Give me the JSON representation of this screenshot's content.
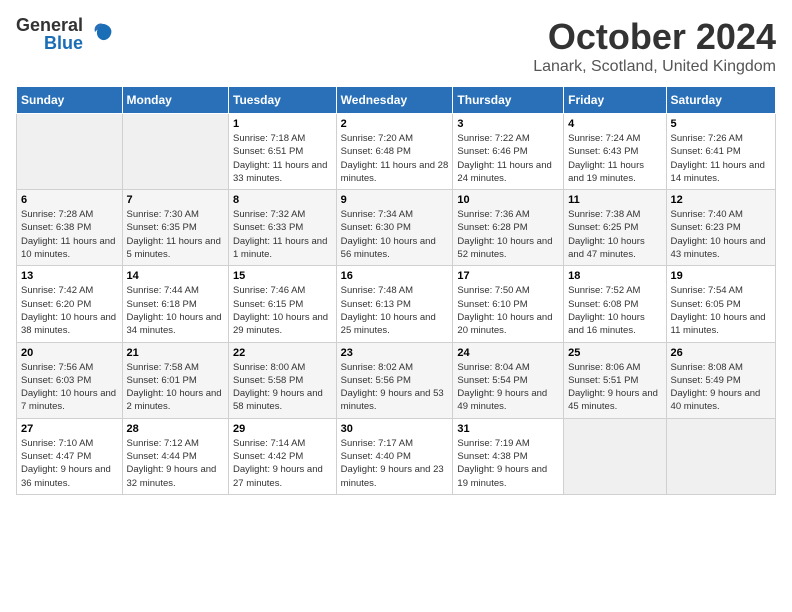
{
  "logo": {
    "general": "General",
    "blue": "Blue"
  },
  "title": "October 2024",
  "subtitle": "Lanark, Scotland, United Kingdom",
  "days_of_week": [
    "Sunday",
    "Monday",
    "Tuesday",
    "Wednesday",
    "Thursday",
    "Friday",
    "Saturday"
  ],
  "weeks": [
    [
      {
        "day": "",
        "sunrise": "",
        "sunset": "",
        "daylight": ""
      },
      {
        "day": "",
        "sunrise": "",
        "sunset": "",
        "daylight": ""
      },
      {
        "day": "1",
        "sunrise": "Sunrise: 7:18 AM",
        "sunset": "Sunset: 6:51 PM",
        "daylight": "Daylight: 11 hours and 33 minutes."
      },
      {
        "day": "2",
        "sunrise": "Sunrise: 7:20 AM",
        "sunset": "Sunset: 6:48 PM",
        "daylight": "Daylight: 11 hours and 28 minutes."
      },
      {
        "day": "3",
        "sunrise": "Sunrise: 7:22 AM",
        "sunset": "Sunset: 6:46 PM",
        "daylight": "Daylight: 11 hours and 24 minutes."
      },
      {
        "day": "4",
        "sunrise": "Sunrise: 7:24 AM",
        "sunset": "Sunset: 6:43 PM",
        "daylight": "Daylight: 11 hours and 19 minutes."
      },
      {
        "day": "5",
        "sunrise": "Sunrise: 7:26 AM",
        "sunset": "Sunset: 6:41 PM",
        "daylight": "Daylight: 11 hours and 14 minutes."
      }
    ],
    [
      {
        "day": "6",
        "sunrise": "Sunrise: 7:28 AM",
        "sunset": "Sunset: 6:38 PM",
        "daylight": "Daylight: 11 hours and 10 minutes."
      },
      {
        "day": "7",
        "sunrise": "Sunrise: 7:30 AM",
        "sunset": "Sunset: 6:35 PM",
        "daylight": "Daylight: 11 hours and 5 minutes."
      },
      {
        "day": "8",
        "sunrise": "Sunrise: 7:32 AM",
        "sunset": "Sunset: 6:33 PM",
        "daylight": "Daylight: 11 hours and 1 minute."
      },
      {
        "day": "9",
        "sunrise": "Sunrise: 7:34 AM",
        "sunset": "Sunset: 6:30 PM",
        "daylight": "Daylight: 10 hours and 56 minutes."
      },
      {
        "day": "10",
        "sunrise": "Sunrise: 7:36 AM",
        "sunset": "Sunset: 6:28 PM",
        "daylight": "Daylight: 10 hours and 52 minutes."
      },
      {
        "day": "11",
        "sunrise": "Sunrise: 7:38 AM",
        "sunset": "Sunset: 6:25 PM",
        "daylight": "Daylight: 10 hours and 47 minutes."
      },
      {
        "day": "12",
        "sunrise": "Sunrise: 7:40 AM",
        "sunset": "Sunset: 6:23 PM",
        "daylight": "Daylight: 10 hours and 43 minutes."
      }
    ],
    [
      {
        "day": "13",
        "sunrise": "Sunrise: 7:42 AM",
        "sunset": "Sunset: 6:20 PM",
        "daylight": "Daylight: 10 hours and 38 minutes."
      },
      {
        "day": "14",
        "sunrise": "Sunrise: 7:44 AM",
        "sunset": "Sunset: 6:18 PM",
        "daylight": "Daylight: 10 hours and 34 minutes."
      },
      {
        "day": "15",
        "sunrise": "Sunrise: 7:46 AM",
        "sunset": "Sunset: 6:15 PM",
        "daylight": "Daylight: 10 hours and 29 minutes."
      },
      {
        "day": "16",
        "sunrise": "Sunrise: 7:48 AM",
        "sunset": "Sunset: 6:13 PM",
        "daylight": "Daylight: 10 hours and 25 minutes."
      },
      {
        "day": "17",
        "sunrise": "Sunrise: 7:50 AM",
        "sunset": "Sunset: 6:10 PM",
        "daylight": "Daylight: 10 hours and 20 minutes."
      },
      {
        "day": "18",
        "sunrise": "Sunrise: 7:52 AM",
        "sunset": "Sunset: 6:08 PM",
        "daylight": "Daylight: 10 hours and 16 minutes."
      },
      {
        "day": "19",
        "sunrise": "Sunrise: 7:54 AM",
        "sunset": "Sunset: 6:05 PM",
        "daylight": "Daylight: 10 hours and 11 minutes."
      }
    ],
    [
      {
        "day": "20",
        "sunrise": "Sunrise: 7:56 AM",
        "sunset": "Sunset: 6:03 PM",
        "daylight": "Daylight: 10 hours and 7 minutes."
      },
      {
        "day": "21",
        "sunrise": "Sunrise: 7:58 AM",
        "sunset": "Sunset: 6:01 PM",
        "daylight": "Daylight: 10 hours and 2 minutes."
      },
      {
        "day": "22",
        "sunrise": "Sunrise: 8:00 AM",
        "sunset": "Sunset: 5:58 PM",
        "daylight": "Daylight: 9 hours and 58 minutes."
      },
      {
        "day": "23",
        "sunrise": "Sunrise: 8:02 AM",
        "sunset": "Sunset: 5:56 PM",
        "daylight": "Daylight: 9 hours and 53 minutes."
      },
      {
        "day": "24",
        "sunrise": "Sunrise: 8:04 AM",
        "sunset": "Sunset: 5:54 PM",
        "daylight": "Daylight: 9 hours and 49 minutes."
      },
      {
        "day": "25",
        "sunrise": "Sunrise: 8:06 AM",
        "sunset": "Sunset: 5:51 PM",
        "daylight": "Daylight: 9 hours and 45 minutes."
      },
      {
        "day": "26",
        "sunrise": "Sunrise: 8:08 AM",
        "sunset": "Sunset: 5:49 PM",
        "daylight": "Daylight: 9 hours and 40 minutes."
      }
    ],
    [
      {
        "day": "27",
        "sunrise": "Sunrise: 7:10 AM",
        "sunset": "Sunset: 4:47 PM",
        "daylight": "Daylight: 9 hours and 36 minutes."
      },
      {
        "day": "28",
        "sunrise": "Sunrise: 7:12 AM",
        "sunset": "Sunset: 4:44 PM",
        "daylight": "Daylight: 9 hours and 32 minutes."
      },
      {
        "day": "29",
        "sunrise": "Sunrise: 7:14 AM",
        "sunset": "Sunset: 4:42 PM",
        "daylight": "Daylight: 9 hours and 27 minutes."
      },
      {
        "day": "30",
        "sunrise": "Sunrise: 7:17 AM",
        "sunset": "Sunset: 4:40 PM",
        "daylight": "Daylight: 9 hours and 23 minutes."
      },
      {
        "day": "31",
        "sunrise": "Sunrise: 7:19 AM",
        "sunset": "Sunset: 4:38 PM",
        "daylight": "Daylight: 9 hours and 19 minutes."
      },
      {
        "day": "",
        "sunrise": "",
        "sunset": "",
        "daylight": ""
      },
      {
        "day": "",
        "sunrise": "",
        "sunset": "",
        "daylight": ""
      }
    ]
  ]
}
